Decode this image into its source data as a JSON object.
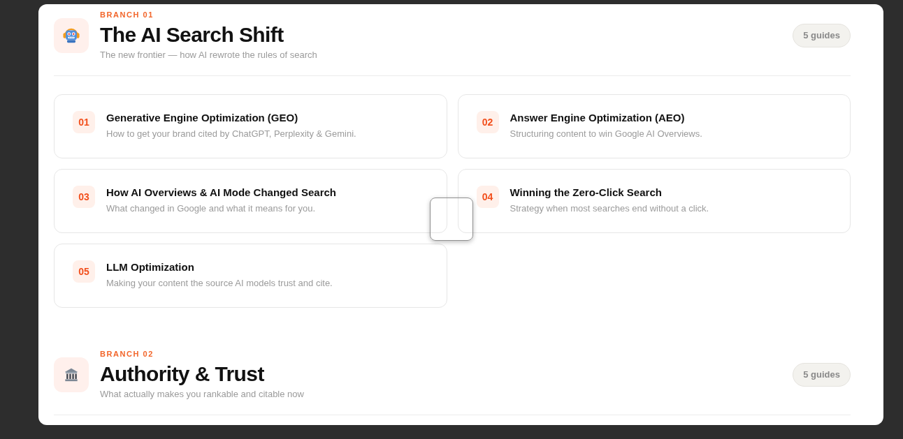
{
  "sections": [
    {
      "label": "BRANCH 01",
      "title": "The AI Search Shift",
      "subtitle": "The new frontier — how AI rewrote the rules of search",
      "count": "5 guides",
      "guides": [
        {
          "number": "01",
          "title": "Generative Engine Optimization (GEO)",
          "description": "How to get your brand cited by ChatGPT, Perplexity & Gemini."
        },
        {
          "number": "02",
          "title": "Answer Engine Optimization (AEO)",
          "description": "Structuring content to win Google AI Overviews."
        },
        {
          "number": "03",
          "title": "How AI Overviews & AI Mode Changed Search",
          "description": "What changed in Google and what it means for you."
        },
        {
          "number": "04",
          "title": "Winning the Zero-Click Search",
          "description": "Strategy when most searches end without a click."
        },
        {
          "number": "05",
          "title": "LLM Optimization",
          "description": "Making your content the source AI models trust and cite."
        }
      ]
    },
    {
      "label": "BRANCH 02",
      "title": "Authority & Trust",
      "subtitle": "What actually makes you rankable and citable now",
      "count": "5 guides"
    }
  ]
}
